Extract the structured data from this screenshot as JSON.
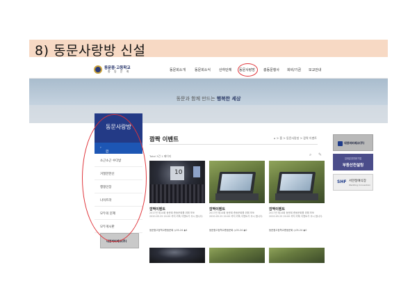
{
  "slide": {
    "heading": "8) 동문사랑방 신설"
  },
  "header": {
    "logo_line1": "동문중·고등학교",
    "logo_line2": "총 동 문 회",
    "menu": [
      "동문회소개",
      "동문회소식",
      "산하단체",
      "동문사랑방",
      "총동문행사",
      "회비/기금",
      "모교안내"
    ],
    "active_menu_index": 3
  },
  "hero": {
    "text_plain": "동문과 함께 만드는 ",
    "text_bold": "행복한 세상"
  },
  "sidebar": {
    "title": "동문사랑방",
    "items": [
      "깜짝 이벤트",
      "소근소근 수다방",
      "거절한한신",
      "행핑인장",
      "나이트라",
      "모두의 문제",
      "모두게시판"
    ],
    "active_index": 0,
    "banner": "대영퍼버베코(주)"
  },
  "content": {
    "title": "깜짝 이벤트",
    "breadcrumb": "⌂  >  홈  >  동문사랑방  >  깜짝 이벤트",
    "total": "Total 3건 1 페이지",
    "cards": [
      {
        "title": "깜짝이벤트",
        "desc": "2017년 제14회 동문회 총동문회를 위해 포토 2020.05.25 20:00 까지 카톡 이벤트가 무시 합니다.",
        "author": "동문중고등학교총동문회",
        "date": "05-24",
        "views": "4",
        "image": "auditorium",
        "screen_text": "10"
      },
      {
        "title": "깜짝이벤트",
        "desc": "2017년 제14회 동문회 총동문회를 위해 포토 2020.05.25 20:00 까지 카톡 이벤트가 무시 합니다.",
        "author": "동문중고등학교총동문회",
        "date": "05-24",
        "views": "0",
        "image": "laptop"
      },
      {
        "title": "깜짝이벤트",
        "desc": "2017년 제14회 동문회 총동문회를 위해 포토 2020.05.25 20:00 까지 카톡 이벤트가 무시 합니다.",
        "author": "동문중고등학교총동문회",
        "date": "05-24",
        "views": "0",
        "image": "laptop"
      }
    ]
  },
  "ads": {
    "ad1": "대영퍼버베코(주)",
    "ad2_sub": "임대분양전문기업",
    "ad2_main": "부동산컨설팅",
    "ad3_badge": "SHF",
    "ad3_title": "서한정예식장",
    "ad3_sub": "Wedding Convention"
  },
  "colors": {
    "accent": "#1d56b4",
    "sidebar_head": "#233a86",
    "highlight_circle": "#e0343a",
    "slide_bar": "#f7d9c4"
  }
}
